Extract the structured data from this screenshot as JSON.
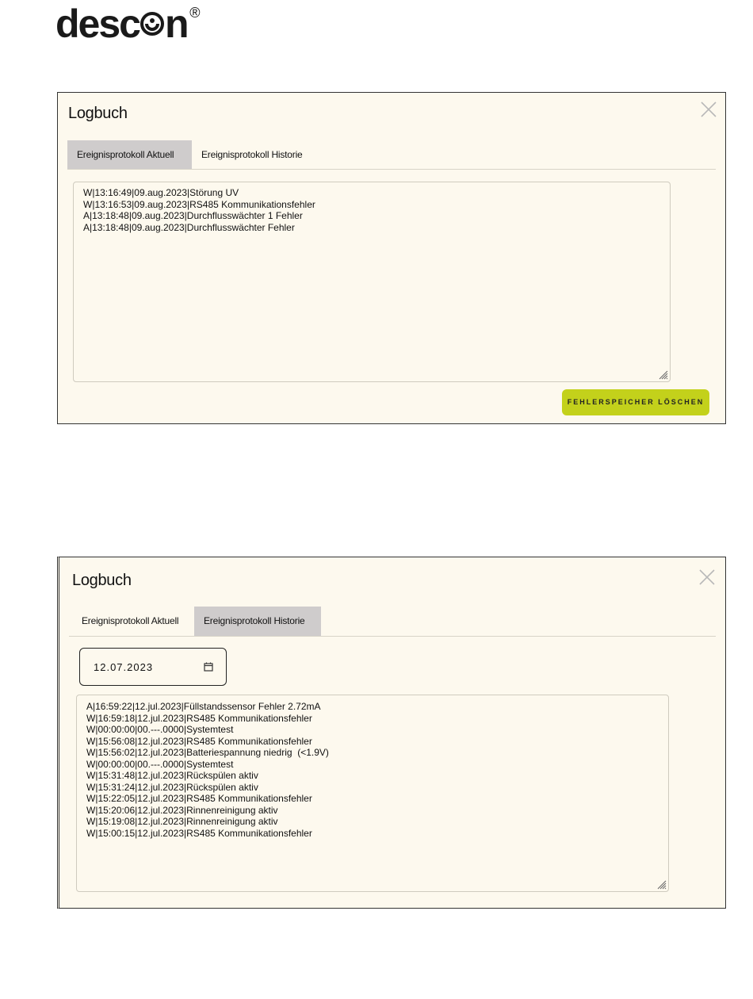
{
  "logo": {
    "text_before": "desc",
    "text_after": "n",
    "registered": "®"
  },
  "panel_current": {
    "title": "Logbuch",
    "close_icon": "close-icon",
    "tabs": [
      {
        "label": "Ereignisprotokoll Aktuell",
        "active": true
      },
      {
        "label": "Ereignisprotokoll Historie",
        "active": false
      }
    ],
    "log_lines": [
      "W|13:16:49|09.aug.2023|Störung UV",
      "W|13:16:53|09.aug.2023|RS485 Kommunikationsfehler",
      "A|13:18:48|09.aug.2023|Durchflusswächter 1 Fehler",
      "A|13:18:48|09.aug.2023|Durchflusswächter Fehler"
    ],
    "clear_button": "FEHLERSPEICHER LÖSCHEN",
    "accent_color": "#c3d11b"
  },
  "panel_history": {
    "title": "Logbuch",
    "close_icon": "close-icon",
    "tabs": [
      {
        "label": "Ereignisprotokoll Aktuell",
        "active": false
      },
      {
        "label": "Ereignisprotokoll Historie",
        "active": true
      }
    ],
    "date_value": "12.07.2023",
    "calendar_icon": "calendar-icon",
    "log_lines": [
      "A|16:59:22|12.jul.2023|Füllstandssensor Fehler 2.72mA",
      "W|16:59:18|12.jul.2023|RS485 Kommunikationsfehler",
      "W|00:00:00|00.---.0000|Systemtest",
      "W|15:56:08|12.jul.2023|RS485 Kommunikationsfehler",
      "W|15:56:02|12.jul.2023|Batteriespannung niedrig  (<1.9V)",
      "W|00:00:00|00.---.0000|Systemtest",
      "W|15:31:48|12.jul.2023|Rückspülen aktiv",
      "W|15:31:24|12.jul.2023|Rückspülen aktiv",
      "W|15:22:05|12.jul.2023|RS485 Kommunikationsfehler",
      "W|15:20:06|12.jul.2023|Rinnenreinigung aktiv",
      "W|15:19:08|12.jul.2023|Rinnenreinigung aktiv",
      "W|15:00:15|12.jul.2023|RS485 Kommunikationsfehler"
    ]
  }
}
